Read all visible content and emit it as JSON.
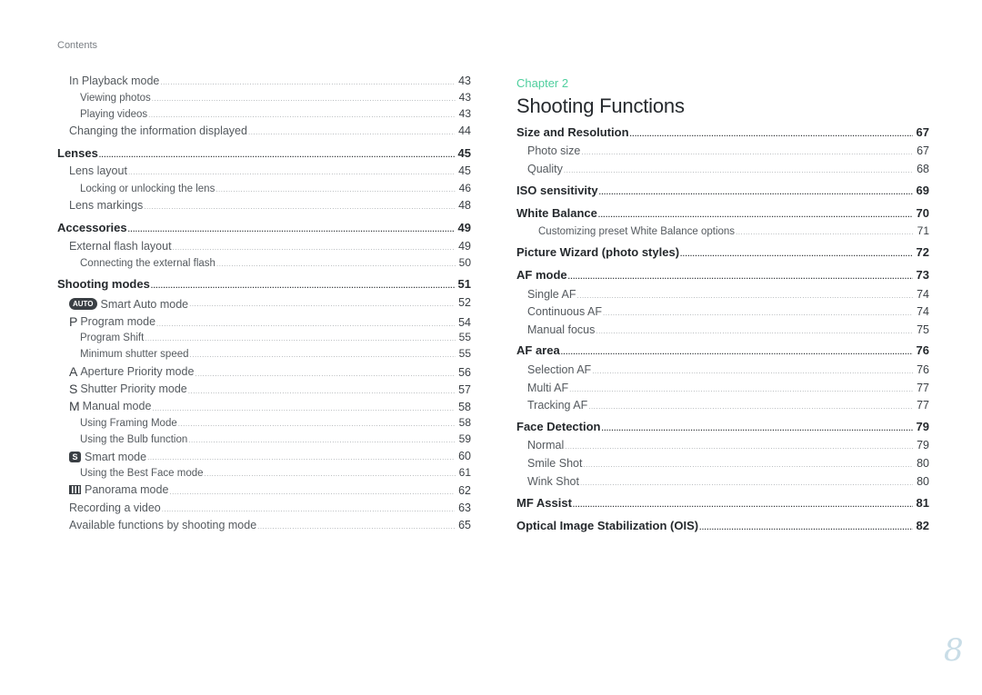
{
  "header": {
    "section_label": "Contents"
  },
  "left_column": {
    "entries": [
      {
        "level": 1,
        "title": "In Playback mode",
        "page": "43"
      },
      {
        "level": 2,
        "title": "Viewing photos",
        "page": "43"
      },
      {
        "level": 2,
        "title": "Playing videos",
        "page": "43"
      },
      {
        "level": 1,
        "title": "Changing the information displayed",
        "page": "44"
      },
      {
        "level": 0,
        "title": "Lenses",
        "page": "45"
      },
      {
        "level": 1,
        "title": "Lens layout",
        "page": "45"
      },
      {
        "level": 2,
        "title": "Locking or unlocking the lens",
        "page": "46"
      },
      {
        "level": 1,
        "title": "Lens markings",
        "page": "48"
      },
      {
        "level": 0,
        "title": "Accessories",
        "page": "49"
      },
      {
        "level": 1,
        "title": "External flash layout",
        "page": "49"
      },
      {
        "level": 2,
        "title": "Connecting the external flash",
        "page": "50"
      },
      {
        "level": 0,
        "title": "Shooting modes",
        "page": "51"
      },
      {
        "level": 1,
        "title": "Smart Auto mode",
        "page": "52",
        "icon": "auto-mode-icon",
        "icon_text": "AUTO"
      },
      {
        "level": 1,
        "title": "Program mode",
        "page": "54",
        "icon": "program-mode-icon",
        "icon_text": "P"
      },
      {
        "level": 2,
        "title": "Program Shift",
        "page": "55"
      },
      {
        "level": 2,
        "title": "Minimum shutter speed",
        "page": "55"
      },
      {
        "level": 1,
        "title": "Aperture Priority mode",
        "page": "56",
        "icon": "aperture-priority-icon",
        "icon_text": "A"
      },
      {
        "level": 1,
        "title": "Shutter Priority mode",
        "page": "57",
        "icon": "shutter-priority-icon",
        "icon_text": "S"
      },
      {
        "level": 1,
        "title": "Manual mode",
        "page": "58",
        "icon": "manual-mode-icon",
        "icon_text": "M"
      },
      {
        "level": 2,
        "title": "Using Framing Mode",
        "page": "58"
      },
      {
        "level": 2,
        "title": "Using the Bulb function",
        "page": "59"
      },
      {
        "level": 1,
        "title": "Smart mode",
        "page": "60",
        "icon": "smart-mode-icon",
        "icon_text": "S"
      },
      {
        "level": 2,
        "title": "Using the Best Face mode",
        "page": "61"
      },
      {
        "level": 1,
        "title": "Panorama mode",
        "page": "62",
        "icon": "panorama-mode-icon",
        "icon_text": ""
      },
      {
        "level": 1,
        "title": "Recording a video",
        "page": "63"
      },
      {
        "level": 1,
        "title": "Available functions by shooting mode",
        "page": "65"
      }
    ]
  },
  "right_column": {
    "chapter_label": "Chapter 2",
    "chapter_title": "Shooting Functions",
    "entries": [
      {
        "level": 0,
        "title": "Size and Resolution",
        "page": "67"
      },
      {
        "level": 1,
        "title": "Photo size",
        "page": "67"
      },
      {
        "level": 1,
        "title": "Quality",
        "page": "68"
      },
      {
        "level": 0,
        "title": "ISO sensitivity",
        "page": "69"
      },
      {
        "level": 0,
        "title": "White Balance",
        "page": "70"
      },
      {
        "level": 2,
        "title": "Customizing preset White Balance options",
        "page": "71"
      },
      {
        "level": 0,
        "title": "Picture Wizard (photo styles)",
        "page": "72"
      },
      {
        "level": 0,
        "title": "AF mode",
        "page": "73"
      },
      {
        "level": 1,
        "title": "Single AF",
        "page": "74"
      },
      {
        "level": 1,
        "title": "Continuous AF",
        "page": "74"
      },
      {
        "level": 1,
        "title": "Manual focus",
        "page": "75"
      },
      {
        "level": 0,
        "title": "AF area",
        "page": "76"
      },
      {
        "level": 1,
        "title": "Selection AF",
        "page": "76"
      },
      {
        "level": 1,
        "title": "Multi AF",
        "page": "77"
      },
      {
        "level": 1,
        "title": "Tracking AF",
        "page": "77"
      },
      {
        "level": 0,
        "title": "Face Detection",
        "page": "79"
      },
      {
        "level": 1,
        "title": "Normal",
        "page": "79"
      },
      {
        "level": 1,
        "title": "Smile Shot",
        "page": "80"
      },
      {
        "level": 1,
        "title": "Wink Shot",
        "page": "80"
      },
      {
        "level": 0,
        "title": "MF Assist",
        "page": "81"
      },
      {
        "level": 0,
        "title": "Optical Image Stabilization (OIS)",
        "page": "82"
      }
    ]
  },
  "footer": {
    "page_number": "8"
  },
  "colors": {
    "chapter_accent": "#4fcf9e",
    "page_number": "#c9dde7",
    "heading_text": "#25292d",
    "body_text": "#555a5f"
  }
}
